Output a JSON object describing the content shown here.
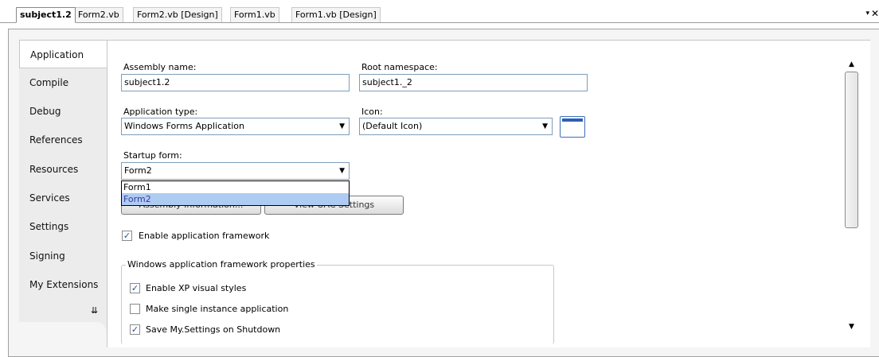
{
  "doc_tabs": [
    {
      "label": "subject1.2",
      "active": true
    },
    {
      "label": "Form2.vb",
      "active": false
    },
    {
      "label": "Form2.vb [Design]",
      "active": false
    },
    {
      "label": "Form1.vb",
      "active": false
    },
    {
      "label": "Form1.vb [Design]",
      "active": false
    }
  ],
  "window_controls": {
    "dropdown": "▾",
    "close": "✕"
  },
  "nav": {
    "items": [
      {
        "label": "Application"
      },
      {
        "label": "Compile"
      },
      {
        "label": "Debug"
      },
      {
        "label": "References"
      },
      {
        "label": "Resources"
      },
      {
        "label": "Services"
      },
      {
        "label": "Settings"
      },
      {
        "label": "Signing"
      },
      {
        "label": "My Extensions"
      }
    ],
    "more_icon": "⇊"
  },
  "form": {
    "assembly_name_label": "Assembly name:",
    "assembly_name_value": "subject1.2",
    "root_namespace_label": "Root namespace:",
    "root_namespace_value": "subject1._2",
    "application_type_label": "Application type:",
    "application_type_value": "Windows Forms Application",
    "icon_label": "Icon:",
    "icon_value": "(Default Icon)",
    "startup_form_label": "Startup form:",
    "startup_form_value": "Form2",
    "startup_options": [
      "Form1",
      "Form2"
    ],
    "assembly_info_button": "Assembly Information...",
    "uac_button": "View UAC Settings",
    "enable_framework_label": "Enable application framework",
    "group_title": "Windows application framework properties",
    "xp_styles_label": "Enable XP visual styles",
    "single_instance_label": "Make single instance application",
    "save_settings_label": "Save My.Settings on Shutdown"
  },
  "icons": {
    "check": "✓",
    "combo_arrow": "▼",
    "scroll_up": "▲",
    "scroll_down": "▼"
  }
}
